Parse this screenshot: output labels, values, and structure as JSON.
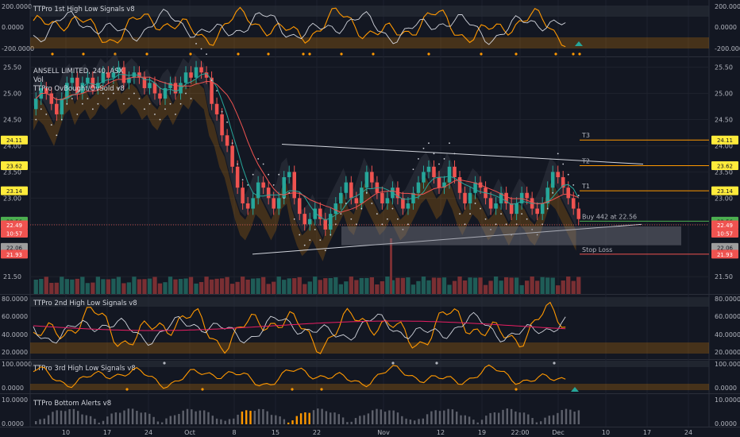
{
  "symbol": "ANSELL LIMITED, 240, ASX",
  "volume_label": "Vol",
  "main_indicator": "TTPro OvBought/OvSold v8",
  "panels": {
    "p1_title": "TTPro 1st High Low Signals v8",
    "p2_title": "TTPro 2nd High Low Signals v8",
    "p3_title": "TTPro 3rd High Low Signals v8",
    "p4_title": "TTPro Bottom Alerts v8"
  },
  "p1_ticks": [
    "200.0000",
    "0.0000",
    "-200.0000"
  ],
  "p2_ticks": [
    "80.0000",
    "60.0000",
    "40.0000",
    "20.0000"
  ],
  "p3_ticks": [
    "100.0000",
    "0.0000"
  ],
  "p4_ticks": [
    "10.0000",
    "0.0000"
  ],
  "price_ticks": [
    "25.50",
    "25.00",
    "24.50",
    "24.00",
    "23.50",
    "23.00",
    "22.50",
    "21.50"
  ],
  "left_price_boxes": [
    "24.11",
    "23.62",
    "23.14",
    "22.56",
    "22.49",
    "10:57",
    "22.06",
    "21.93"
  ],
  "right_price_boxes": [
    "24.11",
    "23.62",
    "23.14",
    "22.56",
    "22.49",
    "10:57",
    "22.06",
    "21.93"
  ],
  "levels": {
    "t3": "T3",
    "t2": "T2",
    "t1": "T1",
    "buy": "Buy 442 at 22.56",
    "stop": "Stop Loss"
  },
  "x_ticks": [
    "10",
    "17",
    "24",
    "Oct",
    "8",
    "15",
    "22",
    "Nov",
    "12",
    "19",
    "22:00",
    "Dec",
    "10",
    "17",
    "24"
  ],
  "colors": {
    "background": "#131722",
    "up": "#26a69a",
    "down": "#ef5350",
    "orange": "#ff9800",
    "target": "#ff9800",
    "buy": "#4caf50",
    "stop": "#ef5350"
  },
  "chart_data": {
    "type": "candlestick",
    "y_range": [
      21.2,
      25.6
    ],
    "close": [
      24.9,
      25.1,
      25.0,
      24.8,
      24.6,
      24.9,
      25.2,
      25.3,
      25.0,
      25.2,
      25.3,
      25.1,
      25.2,
      25.4,
      25.3,
      25.4,
      25.5,
      25.2,
      25.3,
      25.4,
      25.3,
      25.1,
      25.2,
      25.0,
      24.9,
      25.1,
      25.2,
      25.0,
      25.2,
      25.4,
      25.3,
      25.5,
      25.4,
      25.3,
      24.8,
      24.6,
      24.2,
      24.0,
      23.6,
      23.2,
      22.9,
      22.8,
      23.0,
      23.3,
      23.2,
      23.0,
      22.8,
      23.0,
      23.4,
      23.5,
      23.0,
      22.7,
      22.5,
      22.6,
      22.8,
      22.6,
      22.4,
      22.7,
      22.9,
      23.1,
      23.3,
      23.0,
      22.9,
      23.2,
      23.5,
      23.3,
      23.1,
      22.9,
      23.0,
      23.2,
      23.0,
      22.8,
      22.9,
      23.1,
      23.3,
      23.5,
      23.6,
      23.4,
      23.2,
      23.3,
      23.6,
      23.4,
      23.1,
      22.9,
      23.1,
      23.3,
      23.2,
      23.0,
      22.8,
      22.9,
      23.1,
      22.9,
      22.7,
      22.9,
      23.1,
      23.0,
      22.8,
      22.7,
      22.9,
      23.2,
      23.5,
      23.4,
      23.2,
      23.0,
      22.8,
      22.6
    ],
    "open": [
      24.7,
      24.9,
      25.1,
      25.0,
      24.8,
      24.6,
      24.9,
      25.2,
      25.3,
      25.0,
      25.2,
      25.3,
      25.1,
      25.2,
      25.4,
      25.3,
      25.4,
      25.5,
      25.2,
      25.3,
      25.4,
      25.3,
      25.1,
      25.2,
      25.0,
      24.9,
      25.1,
      25.2,
      25.0,
      25.2,
      25.4,
      25.3,
      25.5,
      25.4,
      25.3,
      24.8,
      24.6,
      24.2,
      24.0,
      23.6,
      23.2,
      22.9,
      22.8,
      23.0,
      23.3,
      23.2,
      23.0,
      22.8,
      23.0,
      23.4,
      23.5,
      23.0,
      22.7,
      22.5,
      22.6,
      22.8,
      22.6,
      22.4,
      22.7,
      22.9,
      23.1,
      23.3,
      23.0,
      22.9,
      23.2,
      23.5,
      23.3,
      23.1,
      22.9,
      23.0,
      23.2,
      23.0,
      22.8,
      22.9,
      23.1,
      23.3,
      23.5,
      23.6,
      23.4,
      23.2,
      23.3,
      23.6,
      23.4,
      23.1,
      22.9,
      23.1,
      23.3,
      23.2,
      23.0,
      22.8,
      22.9,
      23.1,
      22.9,
      22.7,
      22.9,
      23.1,
      23.0,
      22.8,
      22.7,
      22.9,
      23.2,
      23.5,
      23.4,
      23.2,
      23.0,
      22.8
    ],
    "levels": {
      "T3": 24.11,
      "T2": 23.62,
      "T1": 23.14,
      "Buy": 22.56,
      "Stop": 21.93
    }
  }
}
